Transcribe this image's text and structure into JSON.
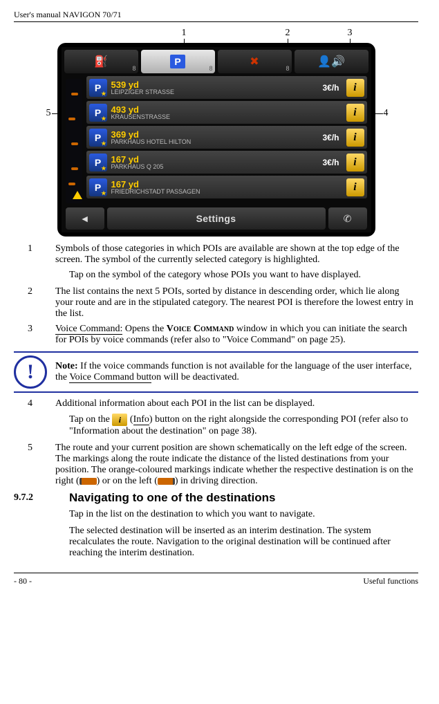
{
  "header": {
    "title": "User's manual NAVIGON 70/71"
  },
  "footer": {
    "left": "- 80 -",
    "right": "Useful functions"
  },
  "callouts": {
    "c1": "1",
    "c2": "2",
    "c3": "3",
    "c4": "4",
    "c5": "5"
  },
  "tabs": [
    {
      "icon": "fuel",
      "count": "8"
    },
    {
      "icon": "parking",
      "count": "8",
      "selected": true
    },
    {
      "icon": "restaurant",
      "count": "8"
    },
    {
      "icon": "voice",
      "count": ""
    }
  ],
  "pois": [
    {
      "dist": "539 yd",
      "street": "LEIPZIGER STRASSE",
      "price": "3€/h",
      "info": true
    },
    {
      "dist": "493 yd",
      "street": "KRAUSENSTRASSE",
      "price": "",
      "info": true
    },
    {
      "dist": "369 yd",
      "street": "PARKHAUS HOTEL HILTON",
      "price": "3€/h",
      "info": true
    },
    {
      "dist": "167 yd",
      "street": "PARKHAUS Q 205",
      "price": "3€/h",
      "info": true
    },
    {
      "dist": "167 yd",
      "street": "FRIEDRICHSTADT PASSAGEN",
      "price": "",
      "info": true
    }
  ],
  "bottombar": {
    "back": "◄",
    "settings": "Settings",
    "call": "✆"
  },
  "desc": {
    "n1": "1",
    "t1": "Symbols of those categories in which POIs are available are shown at the top edge of the screen. The symbol of the currently selected category is highlighted.",
    "t1b": "Tap on the symbol of the category whose POIs you want to have displayed.",
    "n2": "2",
    "t2": "The list contains the next 5 POIs, sorted by distance in descending order, which lie along your route and are in the stipulated category. The nearest POI is therefore the lowest entry in the list.",
    "n3": "3",
    "t3a": "Voice Command:",
    "t3b": " Opens the ",
    "t3c": "Voice Command",
    "t3d": " window in which you can initiate the search for POIs by voice commands (refer also to \"Voice Command\" on page 25).",
    "note_b": "Note:",
    "note": " If the voice commands function is not available for the language of the user interface, the ",
    "note_u": "Voice Command butt",
    "note2": "on will be deactivated.",
    "n4": "4",
    "t4": "Additional information about each POI in the list can be displayed.",
    "t4b_a": "Tap on the ",
    "t4b_b": " (",
    "t4b_u": "Info",
    "t4b_c": ") button on the right alongside the corresponding POI (refer also to \"Information about the destination\" on page 38).",
    "n5": "5",
    "t5a": "The route and your current position are shown schematically on the left edge of the screen. The markings along the route indicate the distance of the listed destinations from your position. The orange-coloured markings indicate whether the respective destination is on the right (",
    "t5b": ") or on the left (",
    "t5c": ") in driving direction."
  },
  "section": {
    "num": "9.7.2",
    "title": "Navigating to one of the destinations",
    "p1": "Tap in the list on the destination to which you want to navigate.",
    "p2": "The selected destination will be inserted as an interim destination. The system recalculates the route. Navigation to the original destination will be continued after reaching the interim destination."
  }
}
